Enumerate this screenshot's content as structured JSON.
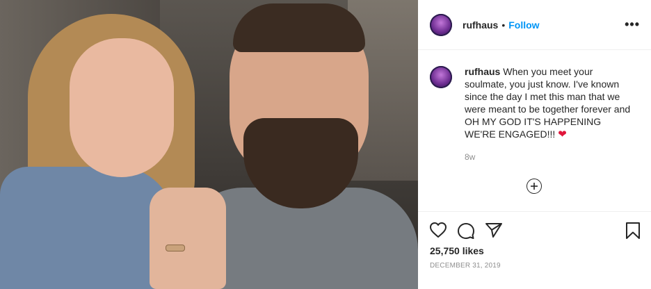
{
  "post": {
    "username": "rufhaus",
    "separator": "•",
    "follow_label": "Follow",
    "more_label": "•••"
  },
  "caption": {
    "username": "rufhaus",
    "text": "When you meet your soulmate, you just know. I've known since the day I met this man that we were meant to be together forever and OH MY GOD IT'S HAPPENING WE'RE ENGAGED!!!",
    "emoji": "❤",
    "time_ago": "8w"
  },
  "engagement": {
    "likes": "25,750 likes",
    "date": "DECEMBER 31, 2019"
  },
  "icons": {
    "like": "heart-icon",
    "comment": "comment-icon",
    "share": "share-icon",
    "save": "bookmark-icon",
    "add_comment": "add-comment-icon",
    "more": "more-options-icon"
  },
  "colors": {
    "accent": "#0095f6",
    "text": "#262626",
    "muted": "#8e8e8e",
    "emoji_heart": "#e0163b"
  }
}
